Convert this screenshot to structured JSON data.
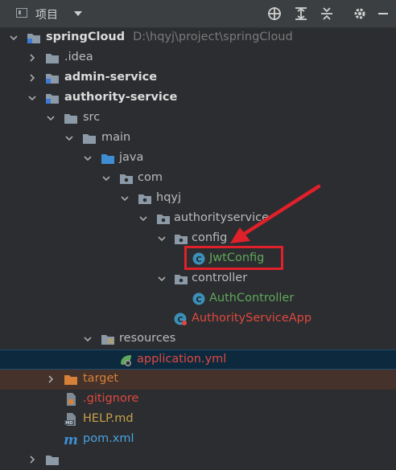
{
  "toolbar": {
    "title": "项目",
    "icons": [
      "locate-icon",
      "expand-all-icon",
      "collapse-all-icon",
      "gear-icon",
      "minimize-icon"
    ]
  },
  "tree": {
    "root": {
      "name": "springCloud",
      "path": "D:\\hqyj\\project\\springCloud"
    },
    "idea": ".idea",
    "admin_service": "admin-service",
    "authority_service": "authority-service",
    "src": "src",
    "main": "main",
    "java": "java",
    "com": "com",
    "hqyj": "hqyj",
    "authorityservice": "authorityservice",
    "config": "config",
    "jwt_config": "JwtConfig",
    "controller": "controller",
    "auth_controller": "AuthController",
    "authority_service_app": "AuthorityServiceApp",
    "resources": "resources",
    "application_yml": "application.yml",
    "target": "target",
    "gitignore": ".gitignore",
    "help_md": "HELP.md",
    "pom_xml": "pom.xml"
  },
  "colors": {
    "background": "#2b2d30",
    "selected_row": "#0d293e",
    "annotation": "#e0202a",
    "modified_file": "#d5813a",
    "new_file": "#5fa85a",
    "ignored": "#c8a24a"
  }
}
